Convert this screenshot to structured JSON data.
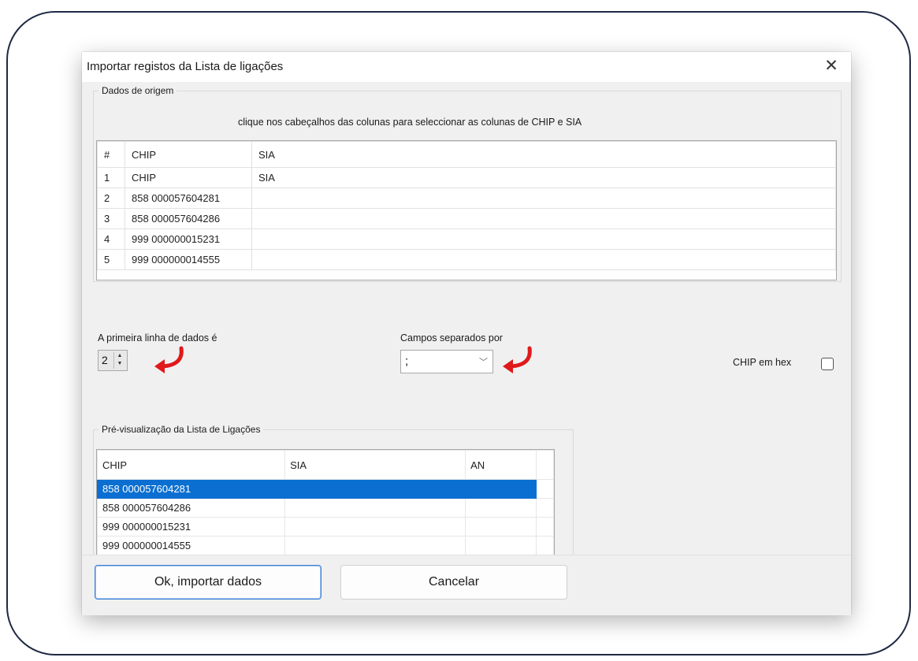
{
  "dialog": {
    "title": "Importar registos da Lista de ligações",
    "close_glyph": "✕"
  },
  "source": {
    "legend": "Dados de origem",
    "hint": "clique nos cabeçalhos das colunas para seleccionar as colunas de CHIP e SIA",
    "columns": [
      "#",
      "CHIP",
      "SIA"
    ],
    "rows": [
      [
        "1",
        "CHIP",
        "SIA"
      ],
      [
        "2",
        "858 000057604281",
        ""
      ],
      [
        "3",
        "858 000057604286",
        ""
      ],
      [
        "4",
        "999 000000015231",
        ""
      ],
      [
        "5",
        "999 000000014555",
        ""
      ]
    ]
  },
  "first_line": {
    "label": "A primeira linha de dados é",
    "value": "2"
  },
  "separator": {
    "label": "Campos separados por",
    "value": ";"
  },
  "hex": {
    "label": "CHIP em hex",
    "checked": false
  },
  "preview": {
    "legend": "Pré-visualização da Lista de Ligações",
    "columns": [
      "CHIP",
      "SIA",
      "AN"
    ],
    "rows": [
      [
        "858 000057604281",
        "",
        ""
      ],
      [
        "858 000057604286",
        "",
        ""
      ],
      [
        "999 000000015231",
        "",
        ""
      ],
      [
        "999 000000014555",
        "",
        ""
      ]
    ],
    "selected_row": 0
  },
  "buttons": {
    "ok": "Ok, importar dados",
    "cancel": "Cancelar"
  },
  "colors": {
    "selection": "#0a6fd1",
    "annotation_arrow": "#e0191b",
    "primary_border": "#3f7fd6"
  }
}
